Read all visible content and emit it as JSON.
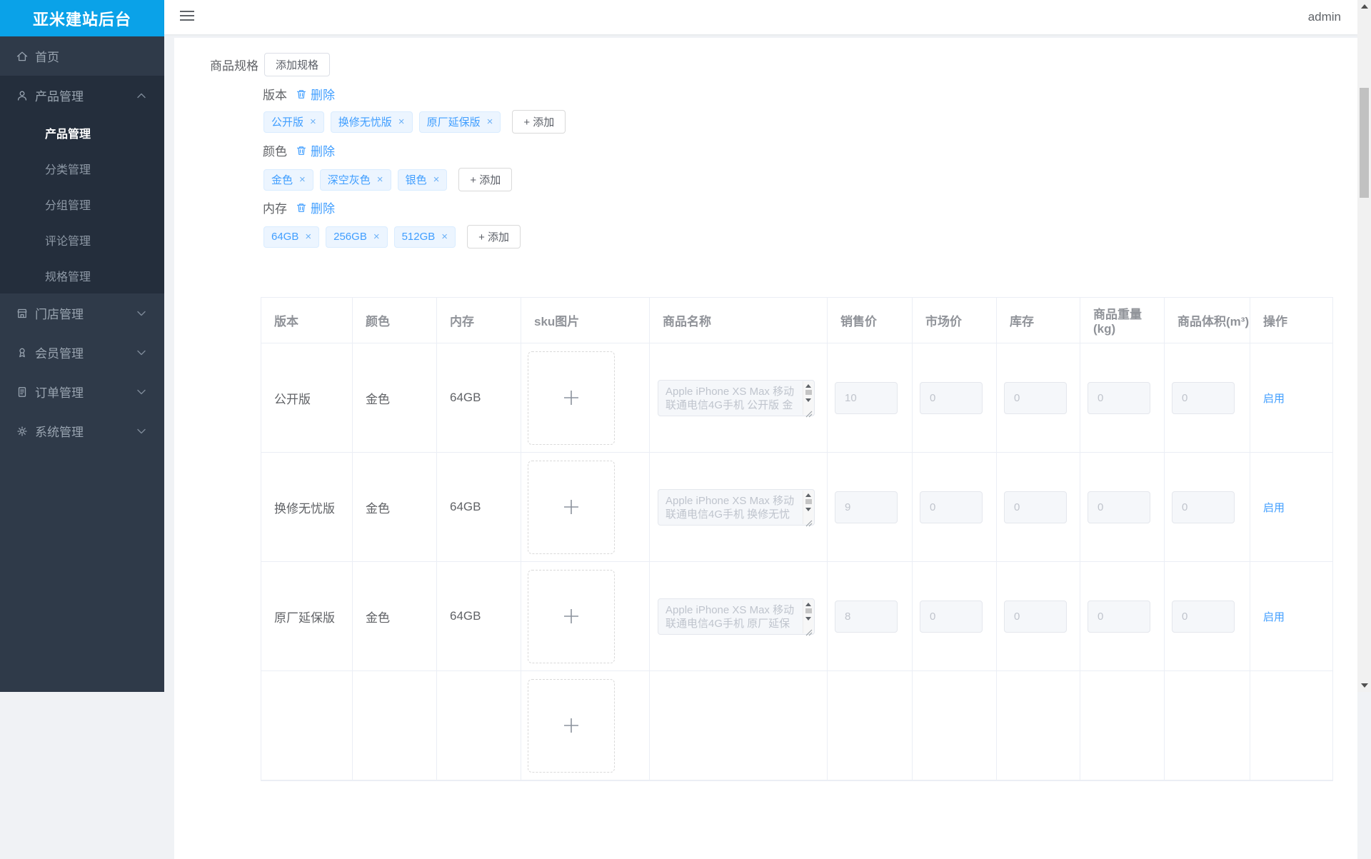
{
  "app": {
    "title": "亚米建站后台"
  },
  "topbar": {
    "user": "admin"
  },
  "sidebar": {
    "items": [
      {
        "label": "首页",
        "icon": "home-icon"
      },
      {
        "label": "产品管理",
        "icon": "user-icon",
        "expanded": true,
        "children": [
          {
            "label": "产品管理",
            "active": true
          },
          {
            "label": "分类管理",
            "active": false
          },
          {
            "label": "分组管理",
            "active": false
          },
          {
            "label": "评论管理",
            "active": false
          },
          {
            "label": "规格管理",
            "active": false
          }
        ]
      },
      {
        "label": "门店管理",
        "icon": "store-icon"
      },
      {
        "label": "会员管理",
        "icon": "member-icon"
      },
      {
        "label": "订单管理",
        "icon": "order-icon"
      },
      {
        "label": "系统管理",
        "icon": "gear-icon"
      }
    ]
  },
  "specs": {
    "title": "商品规格",
    "add_spec_button": "添加规格",
    "delete_label": "删除",
    "add_tag_button": "+ 添加",
    "tag_close_glyph": "×",
    "groups": [
      {
        "name": "版本",
        "tags": [
          "公开版",
          "换修无忧版",
          "原厂延保版"
        ]
      },
      {
        "name": "颜色",
        "tags": [
          "金色",
          "深空灰色",
          "银色"
        ]
      },
      {
        "name": "内存",
        "tags": [
          "64GB",
          "256GB",
          "512GB"
        ]
      }
    ]
  },
  "table": {
    "columns": [
      "版本",
      "颜色",
      "内存",
      "sku图片",
      "商品名称",
      "销售价",
      "市场价",
      "库存",
      "商品重量(kg)",
      "商品体积(m³)",
      "操作"
    ],
    "rows": [
      {
        "version": "公开版",
        "color": "金色",
        "memory": "64GB",
        "name_lines": [
          "Apple iPhone XS Max 移动",
          "联通电信4G手机 公开版 金"
        ],
        "sale_price": "10",
        "market_price": "0",
        "stock": "0",
        "weight": "0",
        "volume": "0",
        "action": "启用"
      },
      {
        "version": "换修无忧版",
        "color": "金色",
        "memory": "64GB",
        "name_lines": [
          "Apple iPhone XS Max 移动",
          "联通电信4G手机 换修无忧"
        ],
        "sale_price": "9",
        "market_price": "0",
        "stock": "0",
        "weight": "0",
        "volume": "0",
        "action": "启用"
      },
      {
        "version": "原厂延保版",
        "color": "金色",
        "memory": "64GB",
        "name_lines": [
          "Apple iPhone XS Max 移动",
          "联通电信4G手机 原厂延保"
        ],
        "sale_price": "8",
        "market_price": "0",
        "stock": "0",
        "weight": "0",
        "volume": "0",
        "action": "启用"
      },
      {
        "version": "",
        "color": "",
        "memory": "",
        "name_lines": [
          "",
          ""
        ],
        "sale_price": "",
        "market_price": "",
        "stock": "",
        "weight": "",
        "volume": "",
        "action": "",
        "partial": true
      }
    ]
  },
  "colors": {
    "accent": "#409eff",
    "logo_bg": "#0aa2e8",
    "sidebar_bg": "#2f3a49",
    "submenu_bg": "#242e3c",
    "tag_bg": "#ecf5ff",
    "tag_border": "#d9ecff",
    "table_border": "#ebeef5",
    "header_text": "#909399",
    "body_text": "#606266",
    "disabled_bg": "#f5f7fa",
    "placeholder_text": "#c0c4cc",
    "page_bg": "#f0f2f5"
  }
}
